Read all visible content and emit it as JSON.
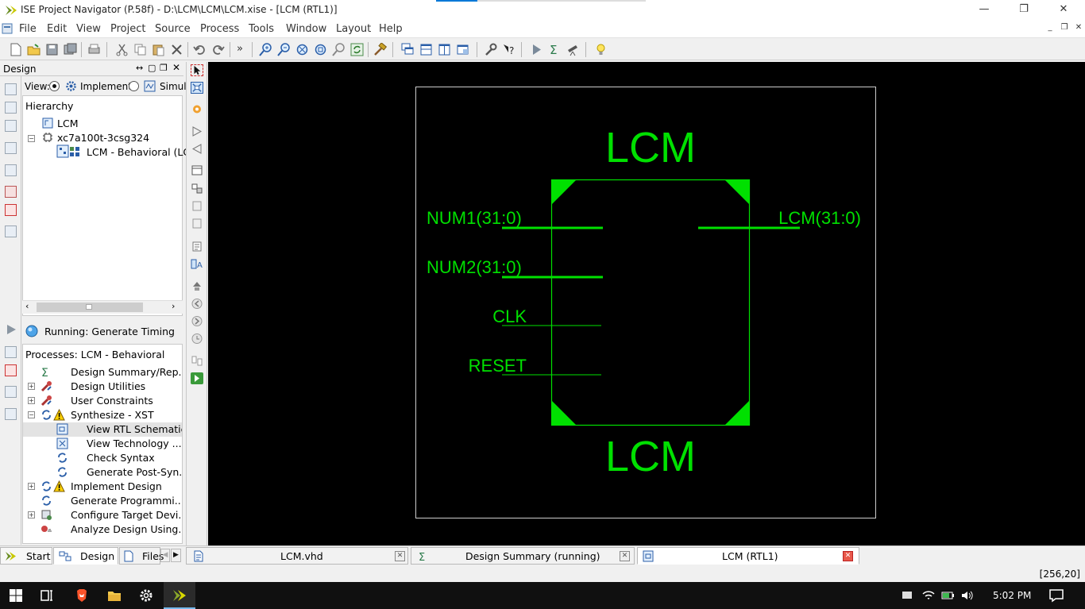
{
  "window": {
    "title": "ISE Project Navigator (P.58f) - D:\\LCM\\LCM\\LCM.xise - [LCM (RTL1)]",
    "minimize": "—",
    "maximize": "❐",
    "close": "✕"
  },
  "menu": {
    "items": [
      "File",
      "Edit",
      "View",
      "Project",
      "Source",
      "Process",
      "Tools",
      "Window",
      "Layout",
      "Help"
    ]
  },
  "design_panel": {
    "header": "Design",
    "view_label": "View:",
    "implementation_label": "Implement",
    "simulation_label": "Simul",
    "hierarchy_label": "Hierarchy",
    "tree": [
      {
        "label": "LCM",
        "icon": "project-icon"
      },
      {
        "label": "xc7a100t-3csg324",
        "icon": "chip-icon"
      },
      {
        "label": "LCM - Behavioral (LC",
        "icon": "vhdl-module-icon"
      }
    ]
  },
  "running": {
    "label": "Running: Generate Timing"
  },
  "processes": {
    "header": "Processes: LCM - Behavioral",
    "items": [
      {
        "label": "Design Summary/Rep...",
        "icon": "sigma-icon"
      },
      {
        "label": "Design Utilities",
        "icon": "tools-icon"
      },
      {
        "label": "User Constraints",
        "icon": "tools-icon"
      },
      {
        "label": "Synthesize - XST",
        "icon": "warning-icon"
      },
      {
        "label": "View RTL Schematic",
        "icon": "schematic-icon"
      },
      {
        "label": "View Technology ...",
        "icon": "schematic-icon"
      },
      {
        "label": "Check Syntax",
        "icon": "refresh-icon"
      },
      {
        "label": "Generate Post-Syn...",
        "icon": "refresh-icon"
      },
      {
        "label": "Implement Design",
        "icon": "warning-icon"
      },
      {
        "label": "Generate Programmi...",
        "icon": "refresh-icon"
      },
      {
        "label": "Configure Target Devi...",
        "icon": "device-icon"
      },
      {
        "label": "Analyze Design Using...",
        "icon": "analyze-icon"
      }
    ]
  },
  "schematic": {
    "top_label": "LCM",
    "bottom_label": "LCM",
    "inputs": [
      "NUM1(31:0)",
      "NUM2(31:0)",
      "CLK",
      "RESET"
    ],
    "outputs": [
      "LCM(31:0)"
    ],
    "wire_color": "#00ff00"
  },
  "bottom_tabs": {
    "left": [
      {
        "label": "Start"
      },
      {
        "label": "Design"
      },
      {
        "label": "Files"
      }
    ],
    "documents": [
      {
        "label": "LCM.vhd"
      },
      {
        "label": "Design Summary (running)"
      },
      {
        "label": "LCM (RTL1)"
      }
    ]
  },
  "status": {
    "coordinates": "[256,20]"
  },
  "taskbar": {
    "time": "5:02 PM"
  }
}
